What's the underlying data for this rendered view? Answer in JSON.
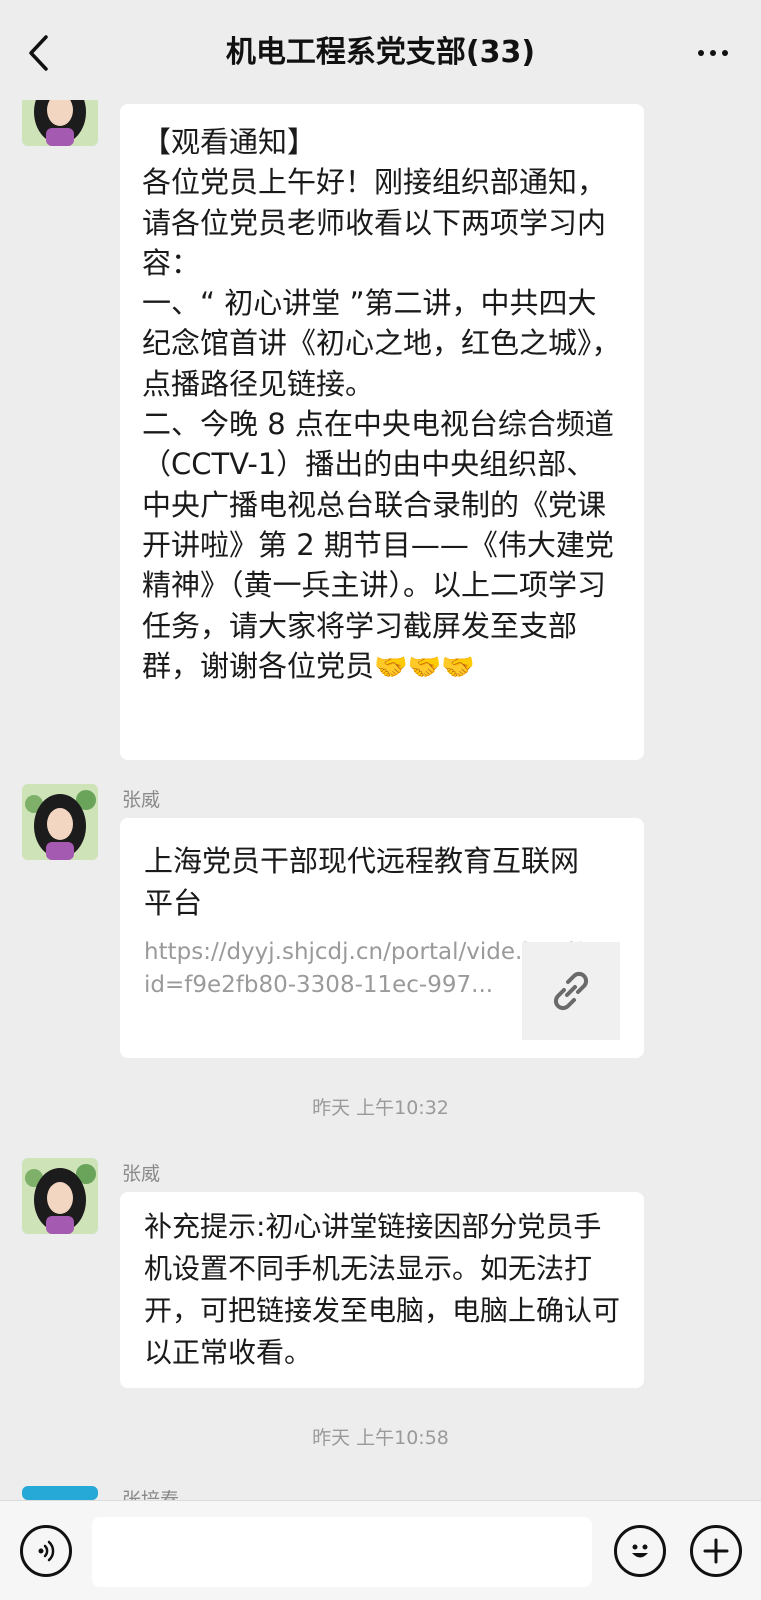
{
  "header": {
    "title": "机电工程系党支部(33)",
    "back_icon": "chevron-left-icon",
    "more_icon": "more-dots-icon"
  },
  "messages": [
    {
      "type": "text",
      "sender": "",
      "text": "【观看通知】\n各位党员上午好！刚接组织部通知，请各位党员老师收看以下两项学习内容：\n一、“ 初心讲堂 ”第二讲，中共四大纪念馆首讲《初心之地，红色之城》，点播路径见链接。\n二、今晚 8 点在中央电视台综合频道（CCTV-1）播出的由中央组织部、中央广播电视总台联合录制的《党课开讲啦》第 2 期节目——《伟大建党精神》（黄一兵主讲）。以上二项学习任务，请大家将学习截屏发至支部群，谢谢各位党员",
      "emoji": "🤝🤝🤝"
    },
    {
      "type": "link",
      "sender": "张威",
      "title": "上海党员干部现代远程教育互联网平台",
      "url": "https://dyyj.shjcdj.cn/portal/vide.html?id=f9e2fb80-3308-11ec-997...",
      "icon": "link-icon"
    },
    {
      "type": "timestamp",
      "text": "昨天 上午10:32"
    },
    {
      "type": "text",
      "sender": "张威",
      "text": "补充提示:初心讲堂链接因部分党员手机设置不同手机无法显示。如无法打开，可把链接发至电脑，电脑上确认可以正常收看。"
    },
    {
      "type": "timestamp",
      "text": "昨天 上午10:58"
    },
    {
      "type": "partial",
      "sender": "张培春"
    }
  ],
  "input_bar": {
    "voice_icon": "voice-icon",
    "emoji_icon": "emoji-icon",
    "plus_icon": "plus-icon"
  },
  "colors": {
    "background": "#ededed",
    "bubble": "#ffffff",
    "muted_text": "#9a9a9a"
  }
}
